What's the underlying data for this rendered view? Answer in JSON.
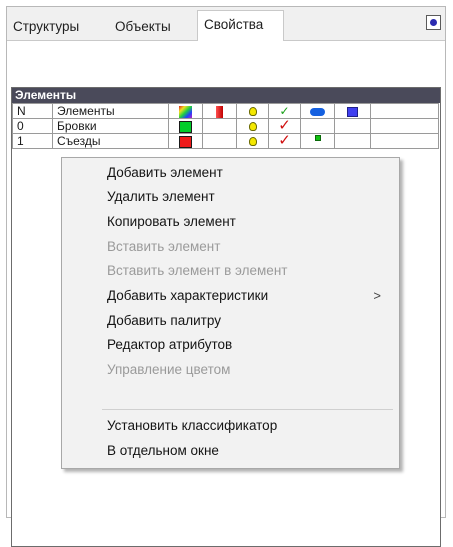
{
  "tabs": [
    "Структуры",
    "Объекты",
    "Свойства"
  ],
  "grid": {
    "title": "Элементы",
    "header": {
      "n": "N",
      "name": "Элементы"
    },
    "rows": [
      {
        "n": "0",
        "name": "Бровки"
      },
      {
        "n": "1",
        "name": "Съезды"
      }
    ]
  },
  "menu": {
    "items": [
      {
        "label": "Добавить элемент",
        "enabled": true
      },
      {
        "label": "Удалить элемент",
        "enabled": true
      },
      {
        "label": "Копировать элемент",
        "enabled": true
      },
      {
        "label": "Вставить элемент",
        "enabled": false
      },
      {
        "label": "Вставить элемент в элемент",
        "enabled": false
      },
      {
        "label": "Добавить характеристики",
        "enabled": true,
        "submenu_arrow": ">"
      },
      {
        "label": "Добавить палитру",
        "enabled": true
      },
      {
        "label": "Редактор атрибутов",
        "enabled": true
      },
      {
        "label": "Управление цветом",
        "enabled": false
      },
      {
        "label": "Установить классификатор",
        "enabled": true
      },
      {
        "label": "В отдельном окне",
        "enabled": true
      }
    ]
  },
  "colors": {
    "header_bar": "#4a4a5a",
    "row0_swatch": "#00cc2a",
    "row1_swatch": "#ee1a1a",
    "disabled_text": "#9a9a9a"
  }
}
